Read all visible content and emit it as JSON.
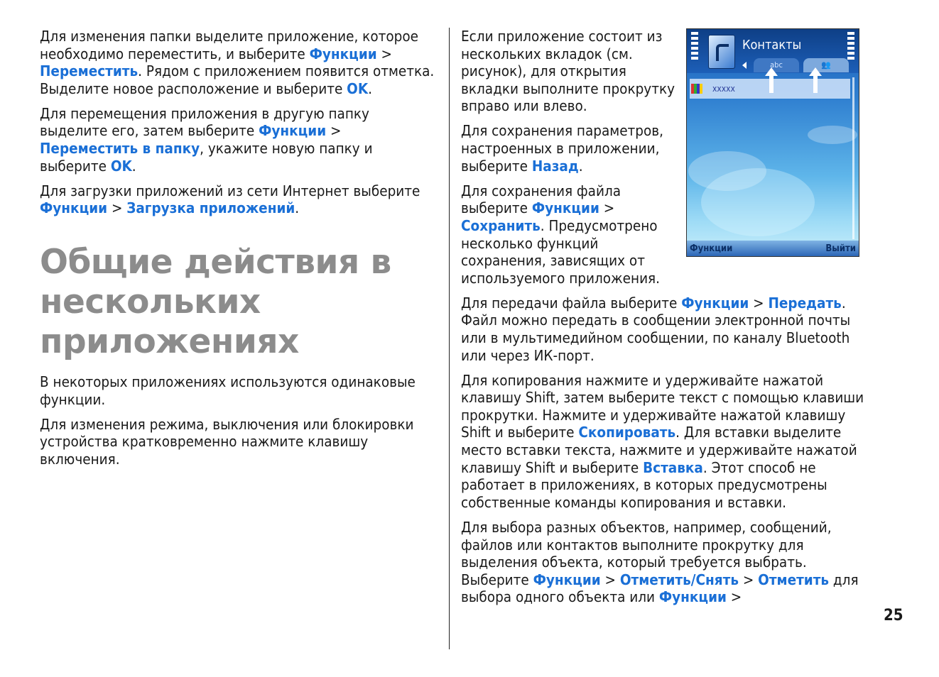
{
  "left": {
    "p1": [
      "Для изменения папки выделите приложение, которое необходимо переместить, и выберите ",
      "Функции",
      " > ",
      "Переместить",
      ". Рядом с приложением появится отметка. Выделите новое расположение и выберите ",
      "OK",
      "."
    ],
    "p2": [
      "Для перемещения приложения в другую папку выделите его, затем выберите ",
      "Функции",
      " > ",
      "Переместить в папку",
      ", укажите новую папку и выберите ",
      "OK",
      "."
    ],
    "p3": [
      "Для загрузки приложений из сети Интернет выберите ",
      "Функции",
      " > ",
      "Загрузка приложений",
      "."
    ],
    "heading": "Общие действия в нескольких приложениях",
    "p4": "В некоторых приложениях используются одинаковые функции.",
    "p5": "Для изменения режима, выключения или блокировки устройства кратковременно нажмите клавишу включения."
  },
  "right": {
    "p1": "Если приложение состоит из нескольких вкладок (см. рисунок), для открытия вкладки выполните прокрутку вправо или влево.",
    "p2": [
      "Для сохранения параметров, настроенных в приложении, выберите ",
      "Назад",
      "."
    ],
    "p3": [
      "Для сохранения файла выберите ",
      "Функции",
      " > ",
      "Сохранить",
      ". Предусмотрено несколько функций сохранения, зависящих от используемого приложения."
    ],
    "p4": [
      "Для передачи файла выберите ",
      "Функции",
      " > ",
      "Передать",
      ". Файл можно передать в сообщении электронной почты или в мультимедийном сообщении, по каналу Bluetooth или через ИК-порт."
    ],
    "p5": [
      "Для копирования нажмите и удерживайте нажатой клавишу Shift, затем выберите текст с помощью клавиши прокрутки. Нажмите и удерживайте нажатой клавишу Shift и выберите ",
      "Скопировать",
      ". Для вставки выделите место вставки текста, нажмите и удерживайте нажатой клавишу Shift и выберите ",
      "Вставка",
      ". Этот способ не работает в приложениях, в которых предусмотрены собственные команды копирования и вставки."
    ],
    "p6": [
      "Для выбора разных объектов, например, сообщений, файлов или контактов выполните прокрутку для выделения объекта, который требуется выбрать. Выберите ",
      "Функции",
      " > ",
      "Отметить/Снять",
      " > ",
      "Отметить",
      " для выбора одного объекта или ",
      "Функции",
      " >"
    ]
  },
  "phone": {
    "title": "Контакты",
    "tab1": "abc",
    "row": "xxxxx",
    "softkey_left": "Функции",
    "softkey_right": "Выйти"
  },
  "page_number": "25",
  "colors": {
    "keyword": "#1a6fd6",
    "heading": "#8c8c8c"
  }
}
